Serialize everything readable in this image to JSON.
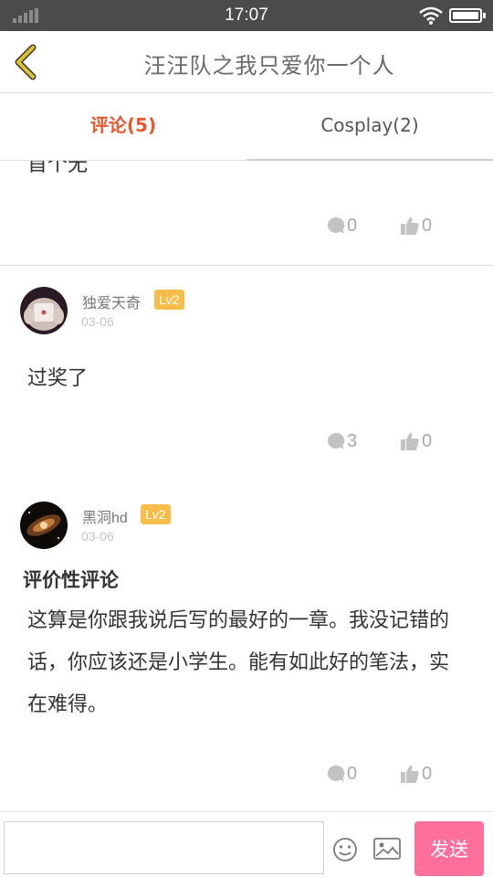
{
  "status_bar": {
    "time": "17:07"
  },
  "header": {
    "title": "汪汪队之我只爱你一个人"
  },
  "tabs": [
    {
      "label": "评论(5)",
      "active": true
    },
    {
      "label": "Cosplay(2)",
      "active": false
    }
  ],
  "partial_comment": {
    "text_fragment": "首个无",
    "replies": "0",
    "likes": "0"
  },
  "comments": [
    {
      "username": "独爱天奇",
      "level": "Lv2",
      "date": "03-06",
      "title": "",
      "body": "过奖了",
      "replies": "3",
      "likes": "0"
    },
    {
      "username": "黑洞hd",
      "level": "Lv2",
      "date": "03-06",
      "title": "评价性评论",
      "body": "这算是你跟我说后写的最好的一章。我没记错的话，你应该还是小学生。能有如此好的笔法，实在难得。",
      "replies": "0",
      "likes": "0"
    }
  ],
  "input_bar": {
    "placeholder": "",
    "send_label": "发送"
  },
  "colors": {
    "accent": "#e8582e",
    "badge": "#f6bd4a",
    "send_button": "#ff6f9c",
    "back_arrow": "#e2c12f"
  },
  "icons": [
    "signal-icon",
    "wifi-icon",
    "battery-icon",
    "back-arrow-icon",
    "comment-bubble-icon",
    "thumbs-up-icon",
    "emoji-icon",
    "image-icon"
  ]
}
